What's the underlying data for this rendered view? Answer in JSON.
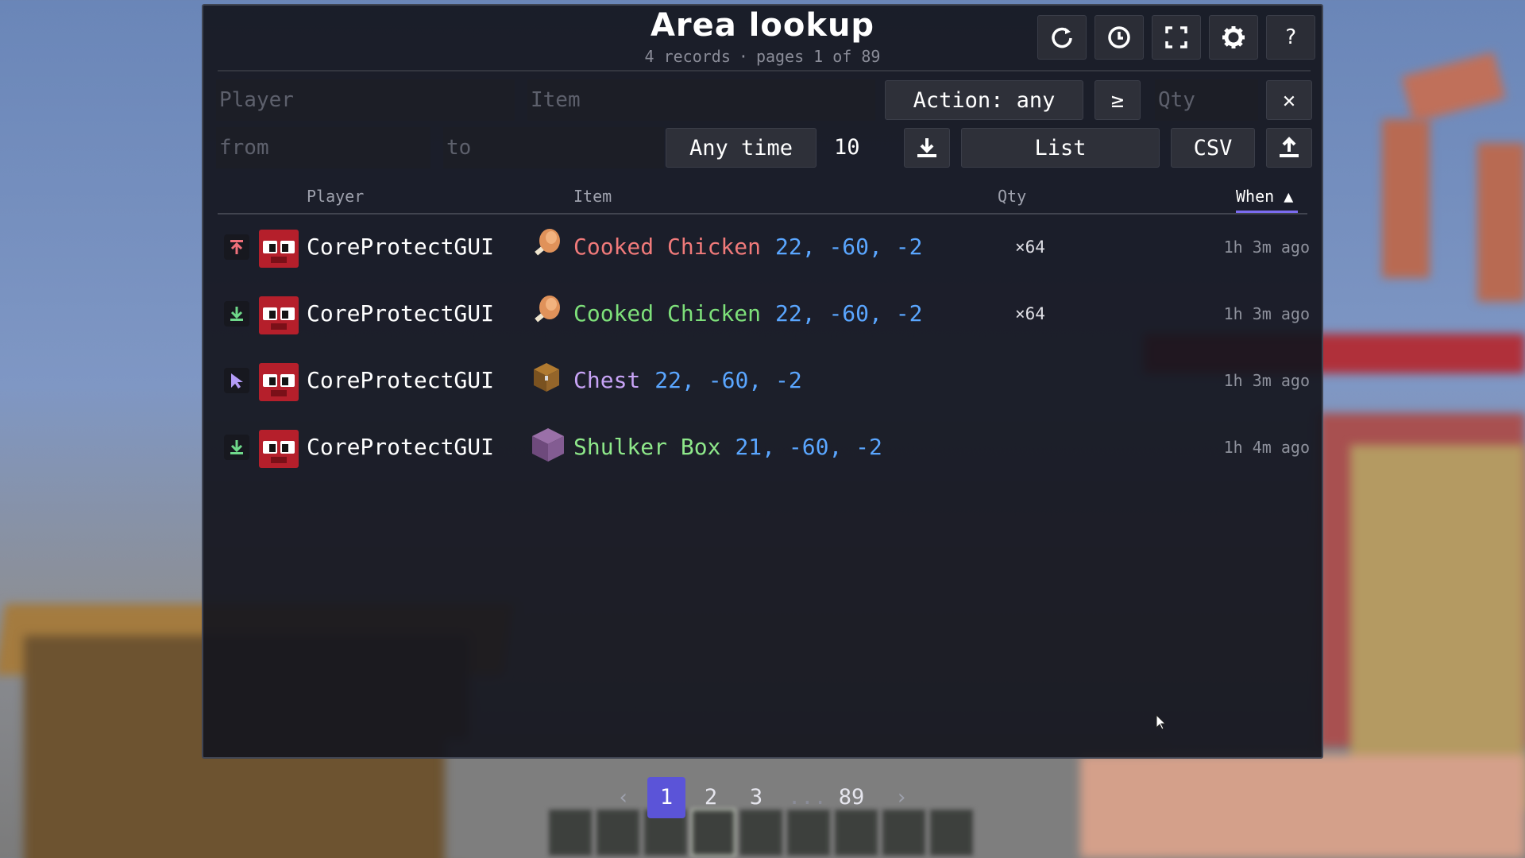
{
  "header": {
    "title": "Area lookup",
    "records": "4 records",
    "separator": "·",
    "pages": "pages 1 of 89",
    "buttons": [
      {
        "icon": "refresh-icon",
        "glyph": "⟳"
      },
      {
        "icon": "clock-icon",
        "glyph": "🕓"
      },
      {
        "icon": "fullscreen-icon",
        "glyph": "⛶"
      },
      {
        "icon": "gear-icon",
        "glyph": "⚙"
      },
      {
        "icon": "help-icon",
        "glyph": "?"
      }
    ]
  },
  "filters": {
    "player_placeholder": "Player",
    "item_placeholder": "Item",
    "action_label": "Action: any",
    "qty_operator": "≥",
    "qty_placeholder": "Qty",
    "clear_glyph": "✕",
    "from_placeholder": "from",
    "to_placeholder": "to",
    "time_label": "Any time",
    "limit_value": "10",
    "download_glyph": "⤓",
    "view_label": "List",
    "csv_label": "CSV",
    "upload_glyph": "⤒"
  },
  "columns": {
    "player": "Player",
    "item": "Item",
    "qty": "Qty",
    "when": "When ▲"
  },
  "rows": [
    {
      "action_icon": "remove-icon",
      "action_glyph": "⇡",
      "action_color": "#f0707a",
      "player": "CoreProtectGUI",
      "item_icon": "cooked-chicken-icon",
      "item": "Cooked Chicken",
      "item_color": "#f07a7a",
      "coords": "22, -60, -2",
      "qty": "×64",
      "when": "1h 3m ago"
    },
    {
      "action_icon": "add-icon",
      "action_glyph": "⤓",
      "action_color": "#6fd88a",
      "player": "CoreProtectGUI",
      "item_icon": "cooked-chicken-icon",
      "item": "Cooked Chicken",
      "item_color": "#7ee07a",
      "coords": "22, -60, -2",
      "qty": "×64",
      "when": "1h 3m ago"
    },
    {
      "action_icon": "click-icon",
      "action_glyph": "⬉",
      "action_color": "#b49cf7",
      "player": "CoreProtectGUI",
      "item_icon": "chest-icon",
      "item": "Chest",
      "item_color": "#c7a3f5",
      "coords": "22, -60, -2",
      "qty": "",
      "when": "1h 3m ago"
    },
    {
      "action_icon": "add-icon",
      "action_glyph": "⤓",
      "action_color": "#6fd88a",
      "player": "CoreProtectGUI",
      "item_icon": "shulker-box-icon",
      "item": "Shulker Box",
      "item_color": "#8ee88a",
      "coords": "21, -60, -2",
      "qty": "",
      "when": "1h 4m ago"
    }
  ],
  "pagination": {
    "prev": "‹",
    "pages": [
      "1",
      "2",
      "3",
      "...",
      "89"
    ],
    "next": "›",
    "active_page": "1"
  },
  "colors": {
    "accent": "#5b54d8",
    "coords": "#5aa6ff"
  }
}
